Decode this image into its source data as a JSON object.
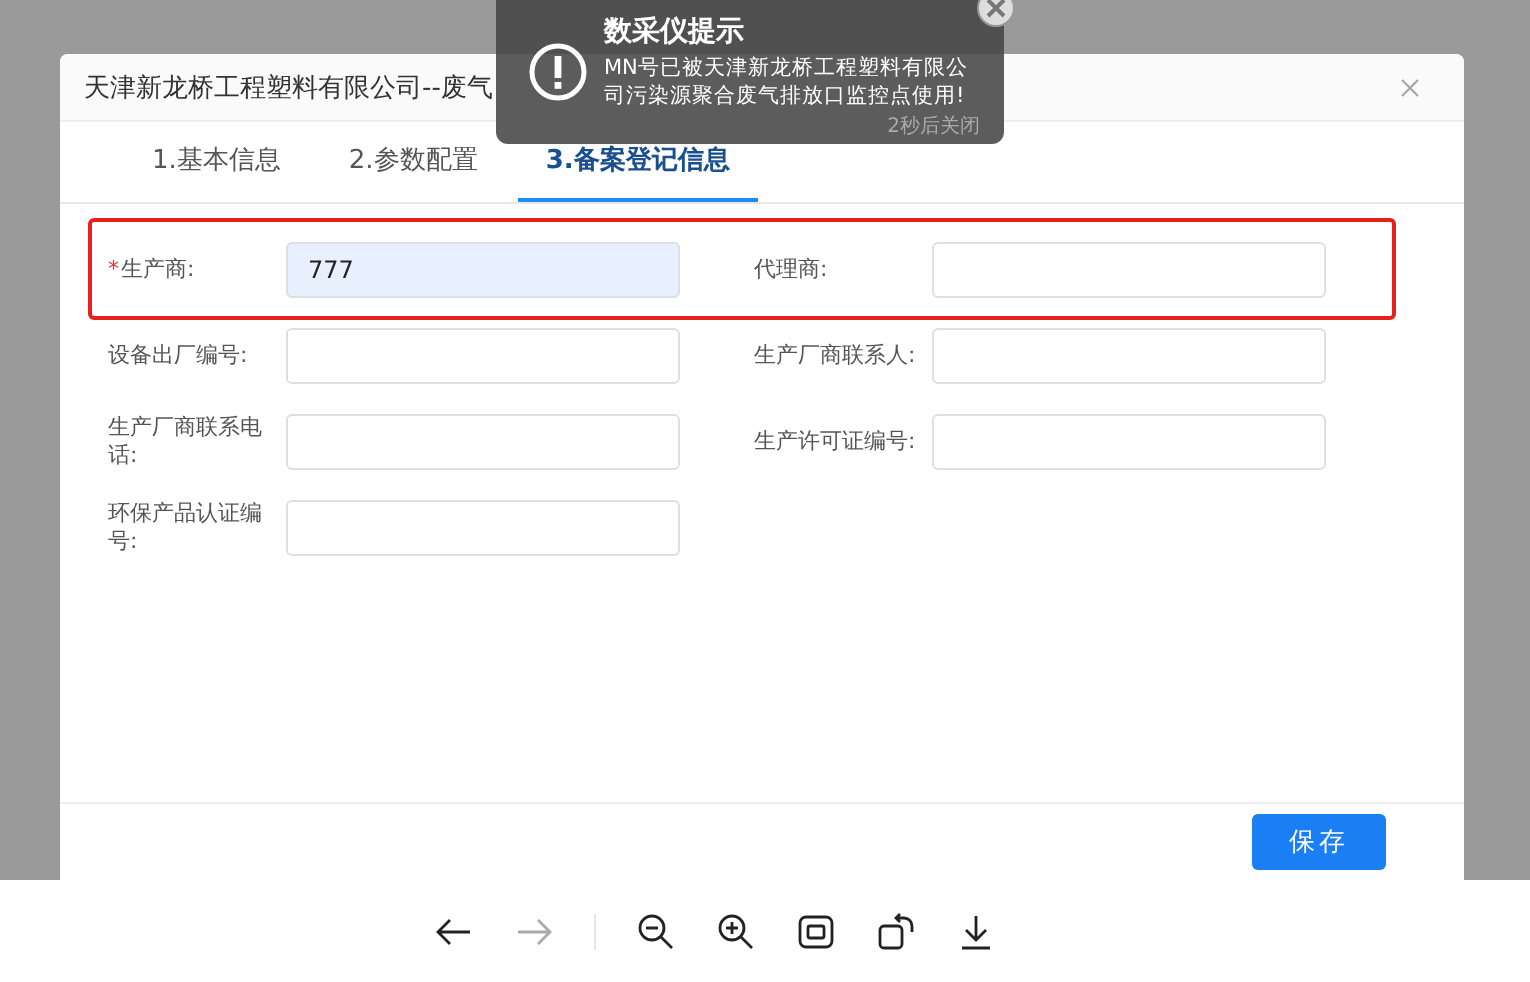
{
  "dialog": {
    "title": "天津新龙桥工程塑料有限公司--废气",
    "tabs": [
      {
        "label": "1.基本信息",
        "selected": false
      },
      {
        "label": "2.参数配置",
        "selected": false
      },
      {
        "label": "3.备案登记信息",
        "selected": true
      }
    ],
    "rows": [
      {
        "highlighted": true,
        "fields": [
          {
            "label": "生产商:",
            "required_mark": "*",
            "value": "777"
          },
          {
            "label": "代理商:"
          }
        ]
      },
      {
        "highlighted": false,
        "fields": [
          {
            "label": "设备出厂编号:"
          },
          {
            "label": "生产厂商联系人:"
          }
        ]
      },
      {
        "highlighted": false,
        "fields": [
          {
            "label": "生产厂商联系电话:"
          },
          {
            "label": "生产许可证编号:"
          }
        ]
      },
      {
        "highlighted": false,
        "fields": [
          {
            "label": "环保产品认证编号:"
          }
        ]
      }
    ],
    "save_button": "保存"
  },
  "toast": {
    "title": "数采仪提示",
    "message": "MN号已被天津新龙桥工程塑料有限公司污染源聚合废气排放口监控点使用!",
    "countdown": "2秒后关闭"
  },
  "toolbar": [
    {
      "kind": "back",
      "disabled": false
    },
    {
      "kind": "forward",
      "disabled": true
    },
    {
      "kind": "divider"
    },
    {
      "kind": "zoom-out",
      "disabled": false
    },
    {
      "kind": "zoom-in",
      "disabled": false
    },
    {
      "kind": "fit",
      "disabled": false
    },
    {
      "kind": "rotate",
      "disabled": false
    },
    {
      "kind": "download",
      "disabled": false
    }
  ]
}
